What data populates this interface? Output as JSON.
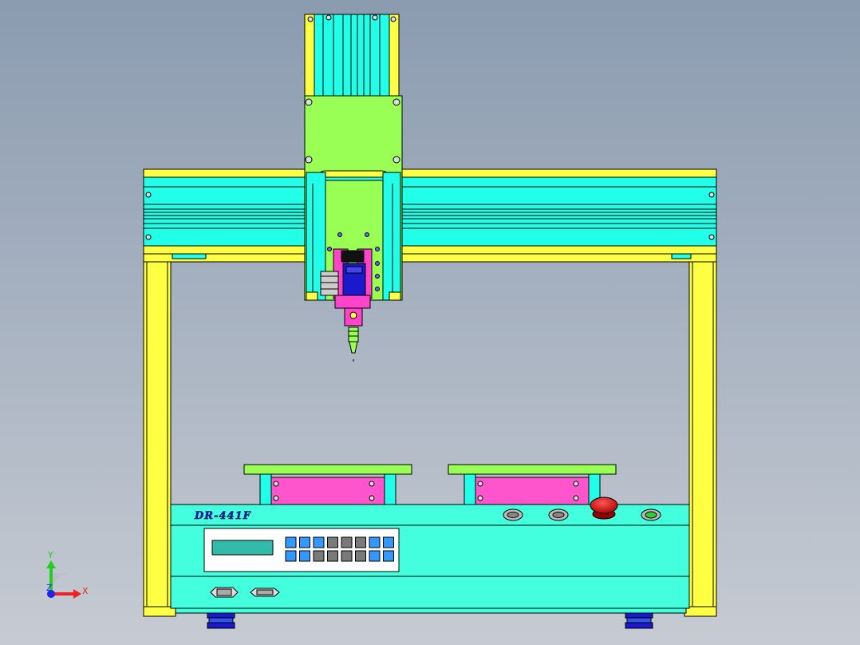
{
  "colors": {
    "bg_top": "#8b9bb0",
    "bg_bottom": "#c4c9d2",
    "frame_yellow": "#ffff44",
    "gantry_cyan": "#22ffe8",
    "carriage_green": "#99ff55",
    "clamp_magenta": "#ff44cc",
    "motor_blue": "#1a1acc",
    "base_aqua": "#44ffdd",
    "fixture_pink": "#ff55cc",
    "estop_red": "#cc1111",
    "lcd_teal": "#33bbaa",
    "key_blue": "#3399ff",
    "key_gray": "#7a7a7a",
    "outline": "#000000"
  },
  "machine": {
    "model_label": "DR-441F"
  },
  "axis_triad": {
    "y_label": "Y",
    "x_label": "X",
    "z_label": "Z"
  },
  "control_panel": {
    "keypad_layout": [
      [
        "blue",
        "blue",
        "blue",
        "gray",
        "gray",
        "gray",
        "blue",
        "blue"
      ],
      [
        "blue",
        "blue",
        "gray",
        "gray",
        "gray",
        "gray",
        "blue",
        "blue"
      ]
    ],
    "buttons": [
      "start-button-left",
      "start-button-right",
      "emergency-stop",
      "power-indicator"
    ]
  },
  "connectors": [
    "serial-port-1",
    "serial-port-2"
  ]
}
